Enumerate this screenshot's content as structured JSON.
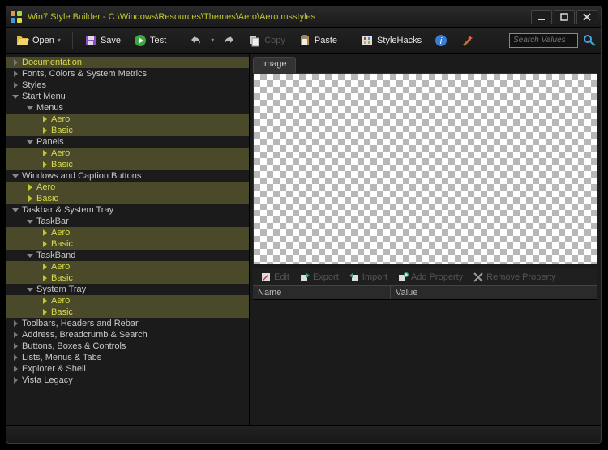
{
  "window": {
    "title": "Win7 Style Builder - C:\\Windows\\Resources\\Themes\\Aero\\Aero.msstyles"
  },
  "toolbar": {
    "open": "Open",
    "save": "Save",
    "test": "Test",
    "copy": "Copy",
    "paste": "Paste",
    "stylehacks": "StyleHacks",
    "search_placeholder": "Search Values"
  },
  "tree": [
    {
      "lvl": 0,
      "exp": false,
      "sel": true,
      "label": "Documentation"
    },
    {
      "lvl": 0,
      "exp": false,
      "sel": false,
      "label": "Fonts, Colors & System Metrics"
    },
    {
      "lvl": 0,
      "exp": false,
      "sel": false,
      "label": "Styles"
    },
    {
      "lvl": 0,
      "exp": true,
      "sel": false,
      "label": "Start Menu"
    },
    {
      "lvl": 1,
      "exp": true,
      "sel": false,
      "label": "Menus"
    },
    {
      "lvl": 2,
      "exp": false,
      "sel": true,
      "leaf": true,
      "label": "Aero"
    },
    {
      "lvl": 2,
      "exp": false,
      "sel": true,
      "leaf": true,
      "label": "Basic"
    },
    {
      "lvl": 1,
      "exp": true,
      "sel": false,
      "label": "Panels"
    },
    {
      "lvl": 2,
      "exp": false,
      "sel": true,
      "leaf": true,
      "label": "Aero"
    },
    {
      "lvl": 2,
      "exp": false,
      "sel": true,
      "leaf": true,
      "label": "Basic"
    },
    {
      "lvl": 0,
      "exp": true,
      "sel": false,
      "label": "Windows and Caption Buttons"
    },
    {
      "lvl": 1,
      "exp": false,
      "sel": true,
      "leaf": true,
      "label": "Aero"
    },
    {
      "lvl": 1,
      "exp": false,
      "sel": true,
      "leaf": true,
      "label": "Basic"
    },
    {
      "lvl": 0,
      "exp": true,
      "sel": false,
      "label": "Taskbar & System Tray"
    },
    {
      "lvl": 1,
      "exp": true,
      "sel": false,
      "label": "TaskBar"
    },
    {
      "lvl": 2,
      "exp": false,
      "sel": true,
      "leaf": true,
      "label": "Aero"
    },
    {
      "lvl": 2,
      "exp": false,
      "sel": true,
      "leaf": true,
      "label": "Basic"
    },
    {
      "lvl": 1,
      "exp": true,
      "sel": false,
      "label": "TaskBand"
    },
    {
      "lvl": 2,
      "exp": false,
      "sel": true,
      "leaf": true,
      "label": "Aero"
    },
    {
      "lvl": 2,
      "exp": false,
      "sel": true,
      "leaf": true,
      "label": "Basic"
    },
    {
      "lvl": 1,
      "exp": true,
      "sel": false,
      "label": "System Tray"
    },
    {
      "lvl": 2,
      "exp": false,
      "sel": true,
      "leaf": true,
      "label": "Aero"
    },
    {
      "lvl": 2,
      "exp": false,
      "sel": true,
      "leaf": true,
      "label": "Basic"
    },
    {
      "lvl": 0,
      "exp": false,
      "sel": false,
      "label": "Toolbars, Headers and Rebar"
    },
    {
      "lvl": 0,
      "exp": false,
      "sel": false,
      "label": "Address, Breadcrumb & Search"
    },
    {
      "lvl": 0,
      "exp": false,
      "sel": false,
      "label": "Buttons, Boxes & Controls"
    },
    {
      "lvl": 0,
      "exp": false,
      "sel": false,
      "label": "Lists, Menus & Tabs"
    },
    {
      "lvl": 0,
      "exp": false,
      "sel": false,
      "label": "Explorer & Shell"
    },
    {
      "lvl": 0,
      "exp": false,
      "sel": false,
      "label": "Vista Legacy"
    }
  ],
  "preview": {
    "tab": "Image"
  },
  "prop_toolbar": {
    "edit": "Edit",
    "export": "Export",
    "import": "Import",
    "add": "Add Property",
    "remove": "Remove Property"
  },
  "prop_columns": {
    "name": "Name",
    "value": "Value"
  },
  "colors": {
    "accent": "#c1c82f"
  }
}
